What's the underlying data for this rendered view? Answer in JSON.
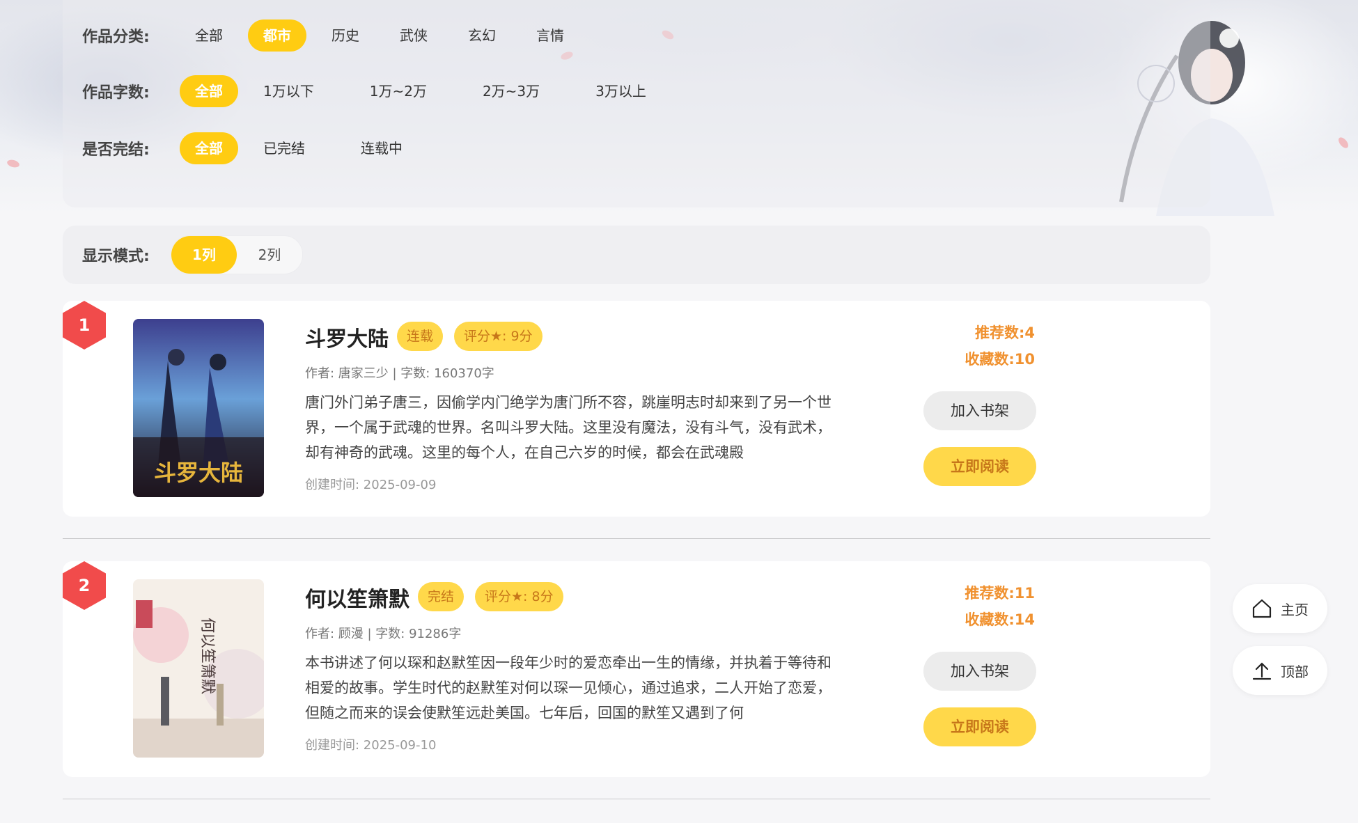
{
  "filters": {
    "category": {
      "label": "作品分类:",
      "options": [
        "全部",
        "都市",
        "历史",
        "武侠",
        "玄幻",
        "言情"
      ],
      "selected": "都市"
    },
    "word_count": {
      "label": "作品字数:",
      "options": [
        "全部",
        "1万以下",
        "1万~2万",
        "2万~3万",
        "3万以上"
      ],
      "selected": "全部"
    },
    "finished": {
      "label": "是否完结:",
      "options": [
        "全部",
        "已完结",
        "连载中"
      ],
      "selected": "全部"
    }
  },
  "display_mode": {
    "label": "显示模式:",
    "options": [
      "1列",
      "2列"
    ],
    "selected": "1列"
  },
  "books": [
    {
      "rank": "1",
      "title": "斗罗大陆",
      "status": "连载",
      "score": "评分★: 9分",
      "meta": "作者: 唐家三少 | 字数: 160370字",
      "desc": "唐门外门弟子唐三，因偷学内门绝学为唐门所不容，跳崖明志时却来到了另一个世界，一个属于武魂的世界。名叫斗罗大陆。这里没有魔法，没有斗气，没有武术，却有神奇的武魂。这里的每个人，在自己六岁的时候，都会在武魂殿",
      "created": "创建时间: 2025-09-09",
      "recommend": "推荐数:4",
      "favorite": "收藏数:10",
      "cover_text": "斗罗大陆",
      "btn_shelf": "加入书架",
      "btn_read": "立即阅读"
    },
    {
      "rank": "2",
      "title": "何以笙箫默",
      "status": "完结",
      "score": "评分★: 8分",
      "meta": "作者: 顾漫 | 字数: 91286字",
      "desc": "本书讲述了何以琛和赵默笙因一段年少时的爱恋牵出一生的情缘，并执着于等待和相爱的故事。学生时代的赵默笙对何以琛一见倾心，通过追求，二人开始了恋爱，但随之而来的误会使默笙远赴美国。七年后，回国的默笙又遇到了何",
      "created": "创建时间: 2025-09-10",
      "recommend": "推荐数:11",
      "favorite": "收藏数:14",
      "cover_text": "何以笙箫默",
      "btn_shelf": "加入书架",
      "btn_read": "立即阅读"
    }
  ],
  "float_nav": {
    "home": "主页",
    "top": "顶部"
  },
  "colors": {
    "accent": "#ffcc12",
    "tag_bg": "#ffd84a",
    "tag_text": "#c7771a",
    "stat": "#f0912f",
    "rank": "#f14b4b"
  },
  "icons": {
    "home": "home-icon",
    "top": "arrow-up-icon"
  }
}
